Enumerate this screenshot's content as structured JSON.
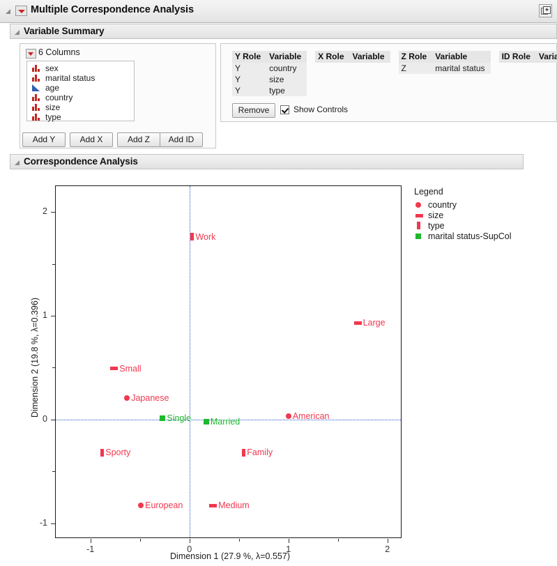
{
  "window": {
    "title": "Multiple Correspondence Analysis",
    "window_icon": "window-restore-icon",
    "disclosure_icon": "disclosure-triangle-icon"
  },
  "sections": {
    "variable_summary": {
      "title": "Variable Summary"
    },
    "correspondence_analysis": {
      "title": "Correspondence Analysis"
    }
  },
  "columns_panel": {
    "header": "6 Columns",
    "items": [
      {
        "label": "sex",
        "icon": "nominal-bars-icon"
      },
      {
        "label": "marital status",
        "icon": "nominal-bars-icon"
      },
      {
        "label": "age",
        "icon": "continuous-triangle-icon"
      },
      {
        "label": "country",
        "icon": "nominal-bars-icon"
      },
      {
        "label": "size",
        "icon": "nominal-bars-icon"
      },
      {
        "label": "type",
        "icon": "nominal-bars-icon"
      }
    ],
    "buttons": {
      "add_y": "Add Y",
      "add_x": "Add X",
      "add_z": "Add Z",
      "add_id": "Add ID"
    }
  },
  "roles_panel": {
    "headers": {
      "y_role": "Y Role",
      "y_variable": "Variable",
      "x_role": "X Role",
      "x_variable": "Variable",
      "z_role": "Z Role",
      "z_variable": "Variable",
      "id_role": "ID Role",
      "id_variable": "Variable"
    },
    "rows": [
      {
        "y_role": "Y",
        "y_variable": "country",
        "x_role": "",
        "x_variable": "",
        "z_role": "Z",
        "z_variable": "marital status",
        "id_role": "",
        "id_variable": ""
      },
      {
        "y_role": "Y",
        "y_variable": "size",
        "x_role": "",
        "x_variable": "",
        "z_role": "",
        "z_variable": "",
        "id_role": "",
        "id_variable": ""
      },
      {
        "y_role": "Y",
        "y_variable": "type",
        "x_role": "",
        "x_variable": "",
        "z_role": "",
        "z_variable": "",
        "id_role": "",
        "id_variable": ""
      }
    ],
    "remove_button": "Remove",
    "show_controls_label": "Show Controls",
    "show_controls_checked": true
  },
  "legend": {
    "title": "Legend",
    "entries": [
      {
        "label": "country",
        "marker": "circle",
        "color": "#f0384f"
      },
      {
        "label": "size",
        "marker": "hbar",
        "color": "#f0384f"
      },
      {
        "label": "type",
        "marker": "vbar",
        "color": "#f0384f"
      },
      {
        "label": "marital status-SupCol",
        "marker": "square",
        "color": "#1db92c"
      }
    ]
  },
  "chart_data": {
    "type": "scatter",
    "title": "",
    "xlabel": "Dimension 1  (27.9 %, λ=0.557)",
    "ylabel": "Dimension 2  (19.8 %, λ=0.396)",
    "xlim": [
      -1.35,
      2.15
    ],
    "ylim": [
      -1.15,
      2.25
    ],
    "xticks": [
      -1,
      0,
      1,
      2
    ],
    "yticks": [
      -1,
      0,
      1,
      2
    ],
    "xtick_labels": [
      "-1",
      "0",
      "1",
      "2"
    ],
    "ytick_labels": [
      "-1",
      "0",
      "1",
      "2"
    ],
    "xminorticks": [
      -0.5,
      0.5,
      1.5
    ],
    "yminorticks": [
      -0.5,
      0.5,
      1.5
    ],
    "grid": false,
    "zero_lines": {
      "x": 0,
      "y": 0,
      "color": "#2a52c8",
      "style": "dotted"
    },
    "series": [
      {
        "name": "country",
        "marker": "circle",
        "color": "#f0384f",
        "points": [
          {
            "label": "Japanese",
            "x": -0.63,
            "y": 0.21
          },
          {
            "label": "American",
            "x": 1.0,
            "y": 0.03
          },
          {
            "label": "European",
            "x": -0.49,
            "y": -0.83
          }
        ]
      },
      {
        "name": "size",
        "marker": "hbar",
        "color": "#f0384f",
        "points": [
          {
            "label": "Large",
            "x": 1.7,
            "y": 0.93
          },
          {
            "label": "Small",
            "x": -0.76,
            "y": 0.49
          },
          {
            "label": "Medium",
            "x": 0.24,
            "y": -0.83
          }
        ]
      },
      {
        "name": "type",
        "marker": "vbar",
        "color": "#f0384f",
        "points": [
          {
            "label": "Work",
            "x": 0.03,
            "y": 1.76
          },
          {
            "label": "Sporty",
            "x": -0.88,
            "y": -0.32
          },
          {
            "label": "Family",
            "x": 0.55,
            "y": -0.32
          }
        ]
      },
      {
        "name": "marital status-SupCol",
        "marker": "square",
        "color": "#1db92c",
        "points": [
          {
            "label": "Single",
            "x": -0.27,
            "y": 0.01
          },
          {
            "label": "Married",
            "x": 0.17,
            "y": -0.02
          }
        ]
      }
    ]
  }
}
